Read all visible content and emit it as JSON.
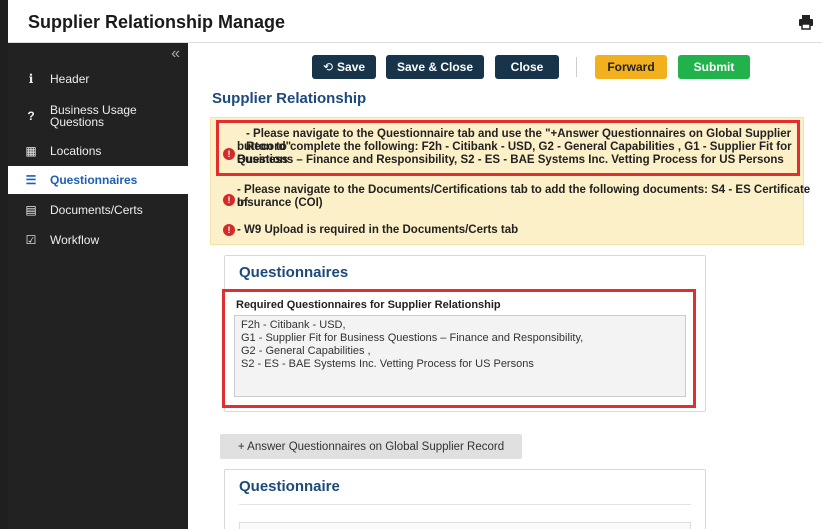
{
  "header": {
    "title": "Supplier Relationship Manage",
    "print_icon": "printer-icon"
  },
  "sidebar": {
    "collapse_label": "«",
    "items": [
      {
        "label": "Header",
        "icon": "info-icon",
        "glyph": "i"
      },
      {
        "label": "Business Usage\nQuestions",
        "icon": "question-icon",
        "glyph": "?"
      },
      {
        "label": "Locations",
        "icon": "map-icon",
        "glyph": "▦"
      },
      {
        "label": "Questionnaires",
        "icon": "list-icon",
        "glyph": "☰"
      },
      {
        "label": "Documents/Certs",
        "icon": "document-icon",
        "glyph": "▤"
      },
      {
        "label": "Workflow",
        "icon": "check-square-icon",
        "glyph": "☑"
      }
    ]
  },
  "toolbar": {
    "save_label": "Save",
    "save_icon": "⟲",
    "save_close_label": "Save & Close",
    "close_label": "Close",
    "forward_label": "Forward",
    "submit_label": "Submit"
  },
  "main": {
    "section_title": "Supplier Relationship",
    "alerts": [
      {
        "line1": "- Please navigate to the Questionnaire tab and use the \"+Answer Questionnaires on Global Supplier Record\"",
        "line2": "button to complete the following: F2h - Citibank - USD, G2 - General Capabilities , G1 - Supplier Fit for Business",
        "line3": "Questions – Finance and Responsibility, S2 - ES - BAE Systems Inc. Vetting Process for US Persons"
      },
      {
        "line1": "- Please navigate to the Documents/Certifications tab to add the following documents: S4 - ES Certificate of",
        "line2": "Insurance (COI)"
      },
      {
        "line1": "- W9 Upload is required in the Documents/Certs tab"
      }
    ],
    "questionnaires_card": {
      "title": "Questionnaires",
      "required_label": "Required Questionnaires for Supplier Relationship",
      "required_lines": [
        "F2h - Citibank - USD,",
        "G1 - Supplier Fit for Business Questions – Finance and Responsibility,",
        "G2 - General Capabilities ,",
        "S2 - ES - BAE Systems Inc. Vetting Process for US Persons"
      ]
    },
    "answer_button": "+ Answer Questionnaires on Global Supplier Record",
    "questionnaire_card": {
      "title": "Questionnaire"
    }
  },
  "colors": {
    "sidebar_bg": "#222222",
    "navy_button": "#17344a",
    "forward": "#f2b01e",
    "submit": "#22b24c",
    "alert_bg": "#fcf0c8",
    "highlight": "#e12f2f",
    "title_blue": "#1d4a7a"
  }
}
